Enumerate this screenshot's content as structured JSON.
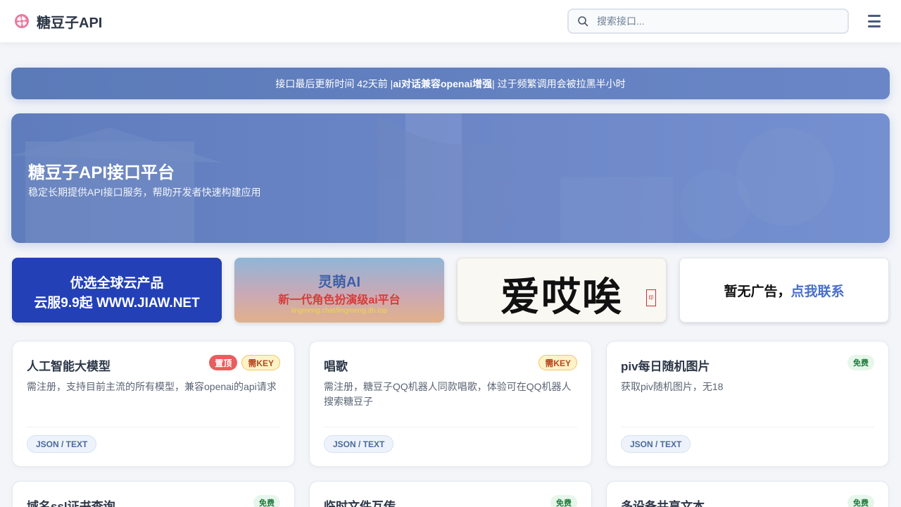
{
  "header": {
    "brand": "糖豆子API",
    "search_placeholder": "搜索接口..."
  },
  "notice": {
    "part1": "接口最后更新时间 42天前 | ",
    "part2": "ai对话兼容openai增强",
    "part3": " | 过于频繁调用会被拉黑半小时"
  },
  "hero": {
    "title": "糖豆子API接口平台",
    "subtitle": "稳定长期提供API接口服务，帮助开发者快速构建应用"
  },
  "ads": {
    "ad1": {
      "line1": "优选全球云产品",
      "line2": "云服9.9起 WWW.JIAW.NET"
    },
    "ad2": {
      "line1": "灵萌AI",
      "line2": "新一代角色扮演级ai平台",
      "line3": "lingmeng.chat/lingmeng.dh.top"
    },
    "ad3": {
      "line1": "爱哎唉"
    },
    "ad4": {
      "text1": "暂无广告，",
      "text2": "点我联系"
    }
  },
  "badges": {
    "top": "置顶",
    "key": "需KEY",
    "free": "免费"
  },
  "cards": [
    {
      "title": "人工智能大模型",
      "desc": "需注册，支持目前主流的所有模型，兼容openai的api请求",
      "format": "JSON / TEXT"
    },
    {
      "title": "唱歌",
      "desc": "需注册，糖豆子QQ机器人同款唱歌，体验可在QQ机器人搜索糖豆子",
      "format": "JSON / TEXT"
    },
    {
      "title": "piv每日随机图片",
      "desc": "获取piv随机图片，无18",
      "format": "JSON / TEXT"
    },
    {
      "title": "域名ssl证书查询",
      "desc": "",
      "format": ""
    },
    {
      "title": "临时文件互传",
      "desc": "",
      "format": ""
    },
    {
      "title": "多设备共享文本",
      "desc": "",
      "format": ""
    }
  ],
  "colors": {
    "accent": "#5b7ab8",
    "badge_top": "#e85d5d",
    "badge_free_text": "#1f7a3a"
  }
}
